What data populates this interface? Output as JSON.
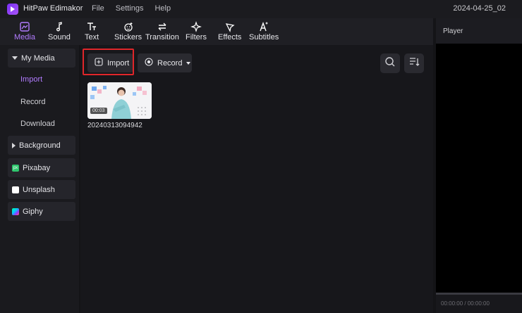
{
  "app": {
    "name": "HitPaw Edimakor",
    "date": "2024-04-25_02"
  },
  "menu": [
    "File",
    "Settings",
    "Help"
  ],
  "toolbar": {
    "tabs": [
      {
        "label": "Media",
        "icon": "media-icon"
      },
      {
        "label": "Sound",
        "icon": "music-note-icon"
      },
      {
        "label": "Text",
        "icon": "text-icon"
      },
      {
        "label": "Stickers",
        "icon": "sticker-icon"
      },
      {
        "label": "Transition",
        "icon": "transition-icon"
      },
      {
        "label": "Filters",
        "icon": "sparkle-icon"
      },
      {
        "label": "Effects",
        "icon": "effects-icon"
      },
      {
        "label": "Subtitles",
        "icon": "subtitles-icon"
      }
    ],
    "active": "Media"
  },
  "sidebar": {
    "my_media": "My Media",
    "sub_items": [
      "Import",
      "Record",
      "Download"
    ],
    "active_sub": "Import",
    "background": "Background",
    "pixabay": "Pixabay",
    "unsplash": "Unsplash",
    "giphy": "Giphy",
    "pixabay_badge": "px"
  },
  "media": {
    "import_label": "Import",
    "record_label": "Record",
    "items": [
      {
        "name": "20240313094942",
        "duration": "00:03"
      }
    ]
  },
  "player": {
    "title": "Player",
    "timecode": "00:00:00 / 00:00:00"
  },
  "colors": {
    "accent": "#b27cff",
    "highlight": "#e0262a"
  }
}
